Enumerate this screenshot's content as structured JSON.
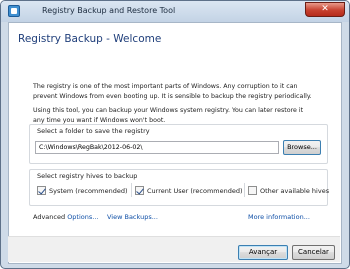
{
  "window": {
    "title": "Registry Backup and Restore Tool",
    "close_glyph": "✕",
    "icon": "registry-app-icon"
  },
  "page": {
    "heading": "Registry Backup - Welcome",
    "description_line1": "The registry is one of the most important parts of Windows. Any corruption to it can",
    "description_line2": "prevent Windows from even booting up. It is sensible to backup the registry periodically.",
    "description_line3": "Using this tool, you can backup your Windows system registry. You can later restore it",
    "description_line4": "any time you want if Windows won't boot."
  },
  "folder_group": {
    "title": "Select a folder to save the registry",
    "path_value": "C:\\Windows\\RegBak\\2012-06-02\\",
    "browse_label": "Browse..."
  },
  "hives_group": {
    "title": "Select registry hives to backup",
    "options": [
      {
        "label": "System (recommended)",
        "checked": true
      },
      {
        "label": "Current User (recommended)",
        "checked": true
      },
      {
        "label": "Other available hives",
        "checked": false
      }
    ]
  },
  "links": {
    "advanced_prefix": "Advanced ",
    "options": "Options...",
    "view_backups": "View Backups...",
    "more_info": "More information..."
  },
  "buttons": {
    "next": "Avançar",
    "cancel": "Cancelar"
  }
}
